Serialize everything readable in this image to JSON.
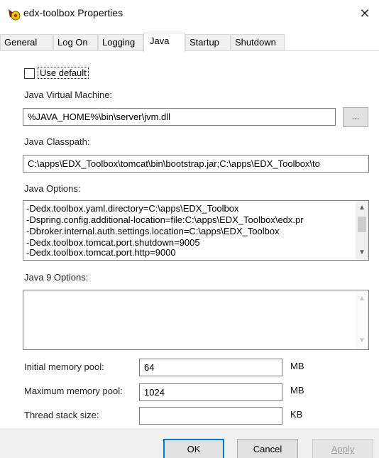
{
  "window": {
    "title": "edx-toolbox Properties",
    "close_glyph": "✕"
  },
  "tabs": [
    {
      "label": "General",
      "active": false
    },
    {
      "label": "Log On",
      "active": false
    },
    {
      "label": "Logging",
      "active": false
    },
    {
      "label": "Java",
      "active": true
    },
    {
      "label": "Startup",
      "active": false
    },
    {
      "label": "Shutdown",
      "active": false
    }
  ],
  "java": {
    "use_default_label": "Use default",
    "use_default_checked": false,
    "jvm_label": "Java Virtual Machine:",
    "jvm_value": "%JAVA_HOME%\\bin\\server\\jvm.dll",
    "browse_label": "...",
    "classpath_label": "Java Classpath:",
    "classpath_value": "C:\\apps\\EDX_Toolbox\\tomcat\\bin\\bootstrap.jar;C:\\apps\\EDX_Toolbox\\to",
    "options_label": "Java Options:",
    "options_lines": [
      "-Dedx.toolbox.yaml.directory=C:\\apps\\EDX_Toolbox",
      "-Dspring.config.additional-location=file:C:\\apps\\EDX_Toolbox\\edx.pr",
      "-Dbroker.internal.auth.settings.location=C:\\apps\\EDX_Toolbox",
      "-Dedx.toolbox.tomcat.port.shutdown=9005",
      "-Dedx.toolbox.tomcat.port.http=9000"
    ],
    "java9_label": "Java 9 Options:",
    "java9_value": ""
  },
  "memory": {
    "initial_label": "Initial memory pool:",
    "initial_value": "64",
    "initial_unit": "MB",
    "max_label": "Maximum memory pool:",
    "max_value": "1024",
    "max_unit": "MB",
    "stack_label": "Thread stack size:",
    "stack_value": "",
    "stack_unit": "KB"
  },
  "buttons": {
    "ok": "OK",
    "cancel": "Cancel",
    "apply": "Apply"
  },
  "icons": {
    "up": "▲",
    "down": "▼"
  },
  "colors": {
    "accent": "#0078d7",
    "panel_bg": "#f0f0f0"
  }
}
